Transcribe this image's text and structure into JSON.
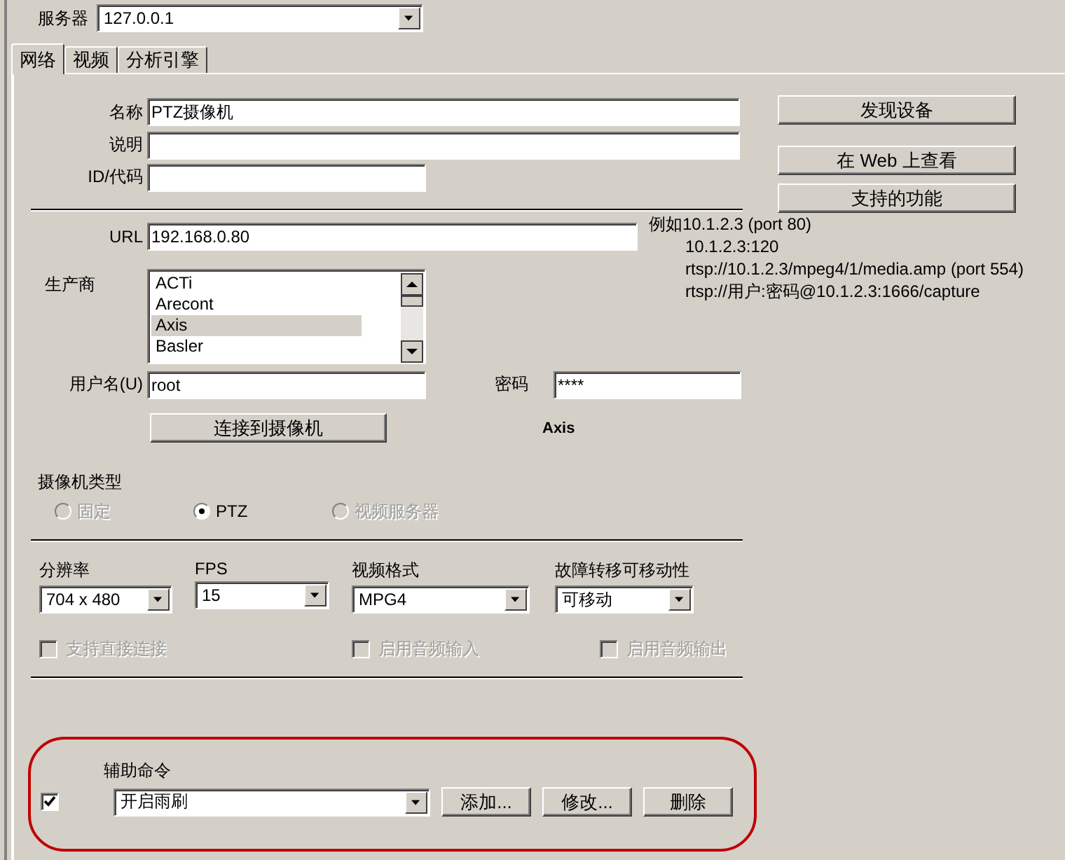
{
  "server": {
    "label": "服务器",
    "value": "127.0.0.1"
  },
  "tabs": [
    {
      "label": "网络",
      "selected": true
    },
    {
      "label": "视频",
      "selected": false
    },
    {
      "label": "分析引擎",
      "selected": false
    }
  ],
  "general_fields": [
    {
      "label": "名称",
      "value": "PTZ摄像机",
      "kind": "wide"
    },
    {
      "label": "说明",
      "kind": "wide"
    },
    {
      "label": "ID/代码",
      "kind": "narrow"
    }
  ],
  "side_buttons": [
    "发现设备",
    "在 Web 上查看",
    "支持的功能"
  ],
  "url": {
    "label": "URL",
    "value": "192.168.0.80"
  },
  "url_examples": [
    "例如10.1.2.3 (port 80)",
    "10.1.2.3:120",
    "rtsp://10.1.2.3/mpeg4/1/media.amp (port 554)",
    "rtsp://用户:密码@10.1.2.3:1666/capture"
  ],
  "manufacturer": {
    "label": "生产商",
    "items": [
      {
        "label": "ACTi",
        "selected": false
      },
      {
        "label": "Arecont",
        "selected": false
      },
      {
        "label": "Axis",
        "selected": true
      },
      {
        "label": "Basler",
        "selected": false
      }
    ]
  },
  "username": {
    "label": "用户名(U)",
    "value": "root"
  },
  "password": {
    "label": "密码",
    "value": "****"
  },
  "connect_button": "连接到摄像机",
  "detected_vendor": "Axis",
  "camera_type": {
    "label": "摄像机类型",
    "options": [
      {
        "label": "固定",
        "selected": false,
        "disabled": true
      },
      {
        "label": "PTZ",
        "selected": true,
        "disabled": false
      },
      {
        "label": "视频服务器",
        "selected": false,
        "disabled": true
      }
    ]
  },
  "stream_settings": [
    {
      "label": "分辨率",
      "value": "704 x 480"
    },
    {
      "label": "FPS",
      "value": "15"
    },
    {
      "label": "视频格式",
      "value": "MPG4"
    },
    {
      "label": "故障转移可移动性",
      "value": "可移动"
    }
  ],
  "options": [
    {
      "label": "支持直接连接",
      "checked": false,
      "disabled": true
    },
    {
      "label": "启用音频输入",
      "checked": false,
      "disabled": true
    },
    {
      "label": "启用音频输出",
      "checked": false,
      "disabled": true
    }
  ],
  "aux_command": {
    "label": "辅助命令",
    "enabled": true,
    "value": "开启雨刷",
    "buttons": [
      "添加...",
      "修改...",
      "删除"
    ]
  }
}
